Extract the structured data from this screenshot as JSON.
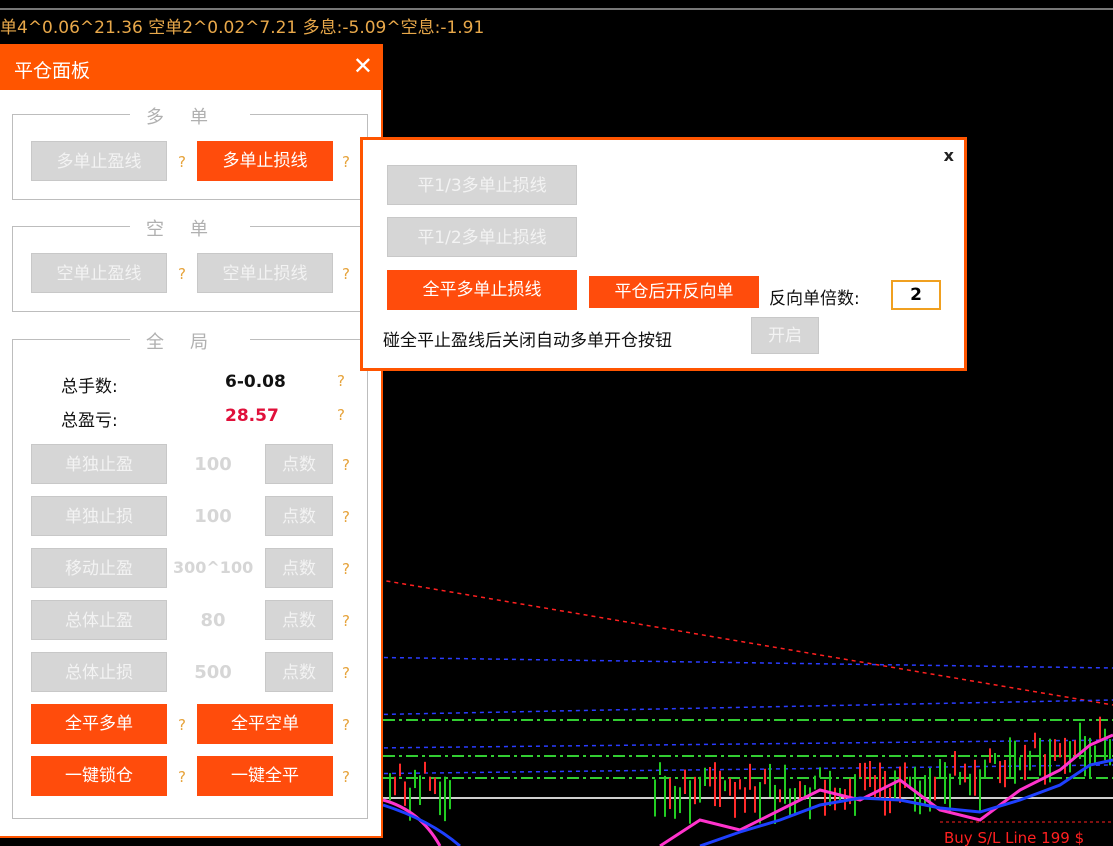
{
  "ticker": "单4^0.06^21.36  空单2^0.02^7.21  多息:-5.09^空息:-1.91",
  "chart": {
    "sl_label": "Buy S/L Line 199 $"
  },
  "panel": {
    "title": "平仓面板",
    "close": "✕",
    "long_group": {
      "legend": "多单",
      "tp_line": "多单止盈线",
      "sl_line": "多单止损线"
    },
    "short_group": {
      "legend": "空单",
      "tp_line": "空单止盈线",
      "sl_line": "空单止损线"
    },
    "global_group": {
      "legend": "全局",
      "total_lots_label": "总手数:",
      "total_lots_value": "6-0.08",
      "total_pl_label": "总盈亏:",
      "total_pl_value": "28.57",
      "rows": [
        {
          "button": "单独止盈",
          "value": "100",
          "unit": "点数"
        },
        {
          "button": "单独止损",
          "value": "100",
          "unit": "点数"
        },
        {
          "button": "移动止盈",
          "value": "300^100",
          "unit": "点数"
        },
        {
          "button": "总体止盈",
          "value": "80",
          "unit": "点数"
        },
        {
          "button": "总体止损",
          "value": "500",
          "unit": "点数"
        }
      ],
      "close_all_long": "全平多单",
      "close_all_short": "全平空单",
      "lock": "一键锁仓",
      "close_all": "一键全平"
    },
    "help": "?"
  },
  "popup": {
    "close": "x",
    "close_third": "平1/3多单止损线",
    "close_half": "平1/2多单止损线",
    "close_all": "全平多单止损线",
    "reverse": "平仓后开反向单",
    "multiplier_label": "反向单倍数:",
    "multiplier_value": "2",
    "auto_close_text": "碰全平止盈线后关闭自动多单开仓按钮",
    "toggle": "开启"
  },
  "colors": {
    "accent": "#ff5500",
    "button_disabled": "#d6d6d6",
    "profit_red": "#e0103a",
    "help": "#e6a33b"
  }
}
